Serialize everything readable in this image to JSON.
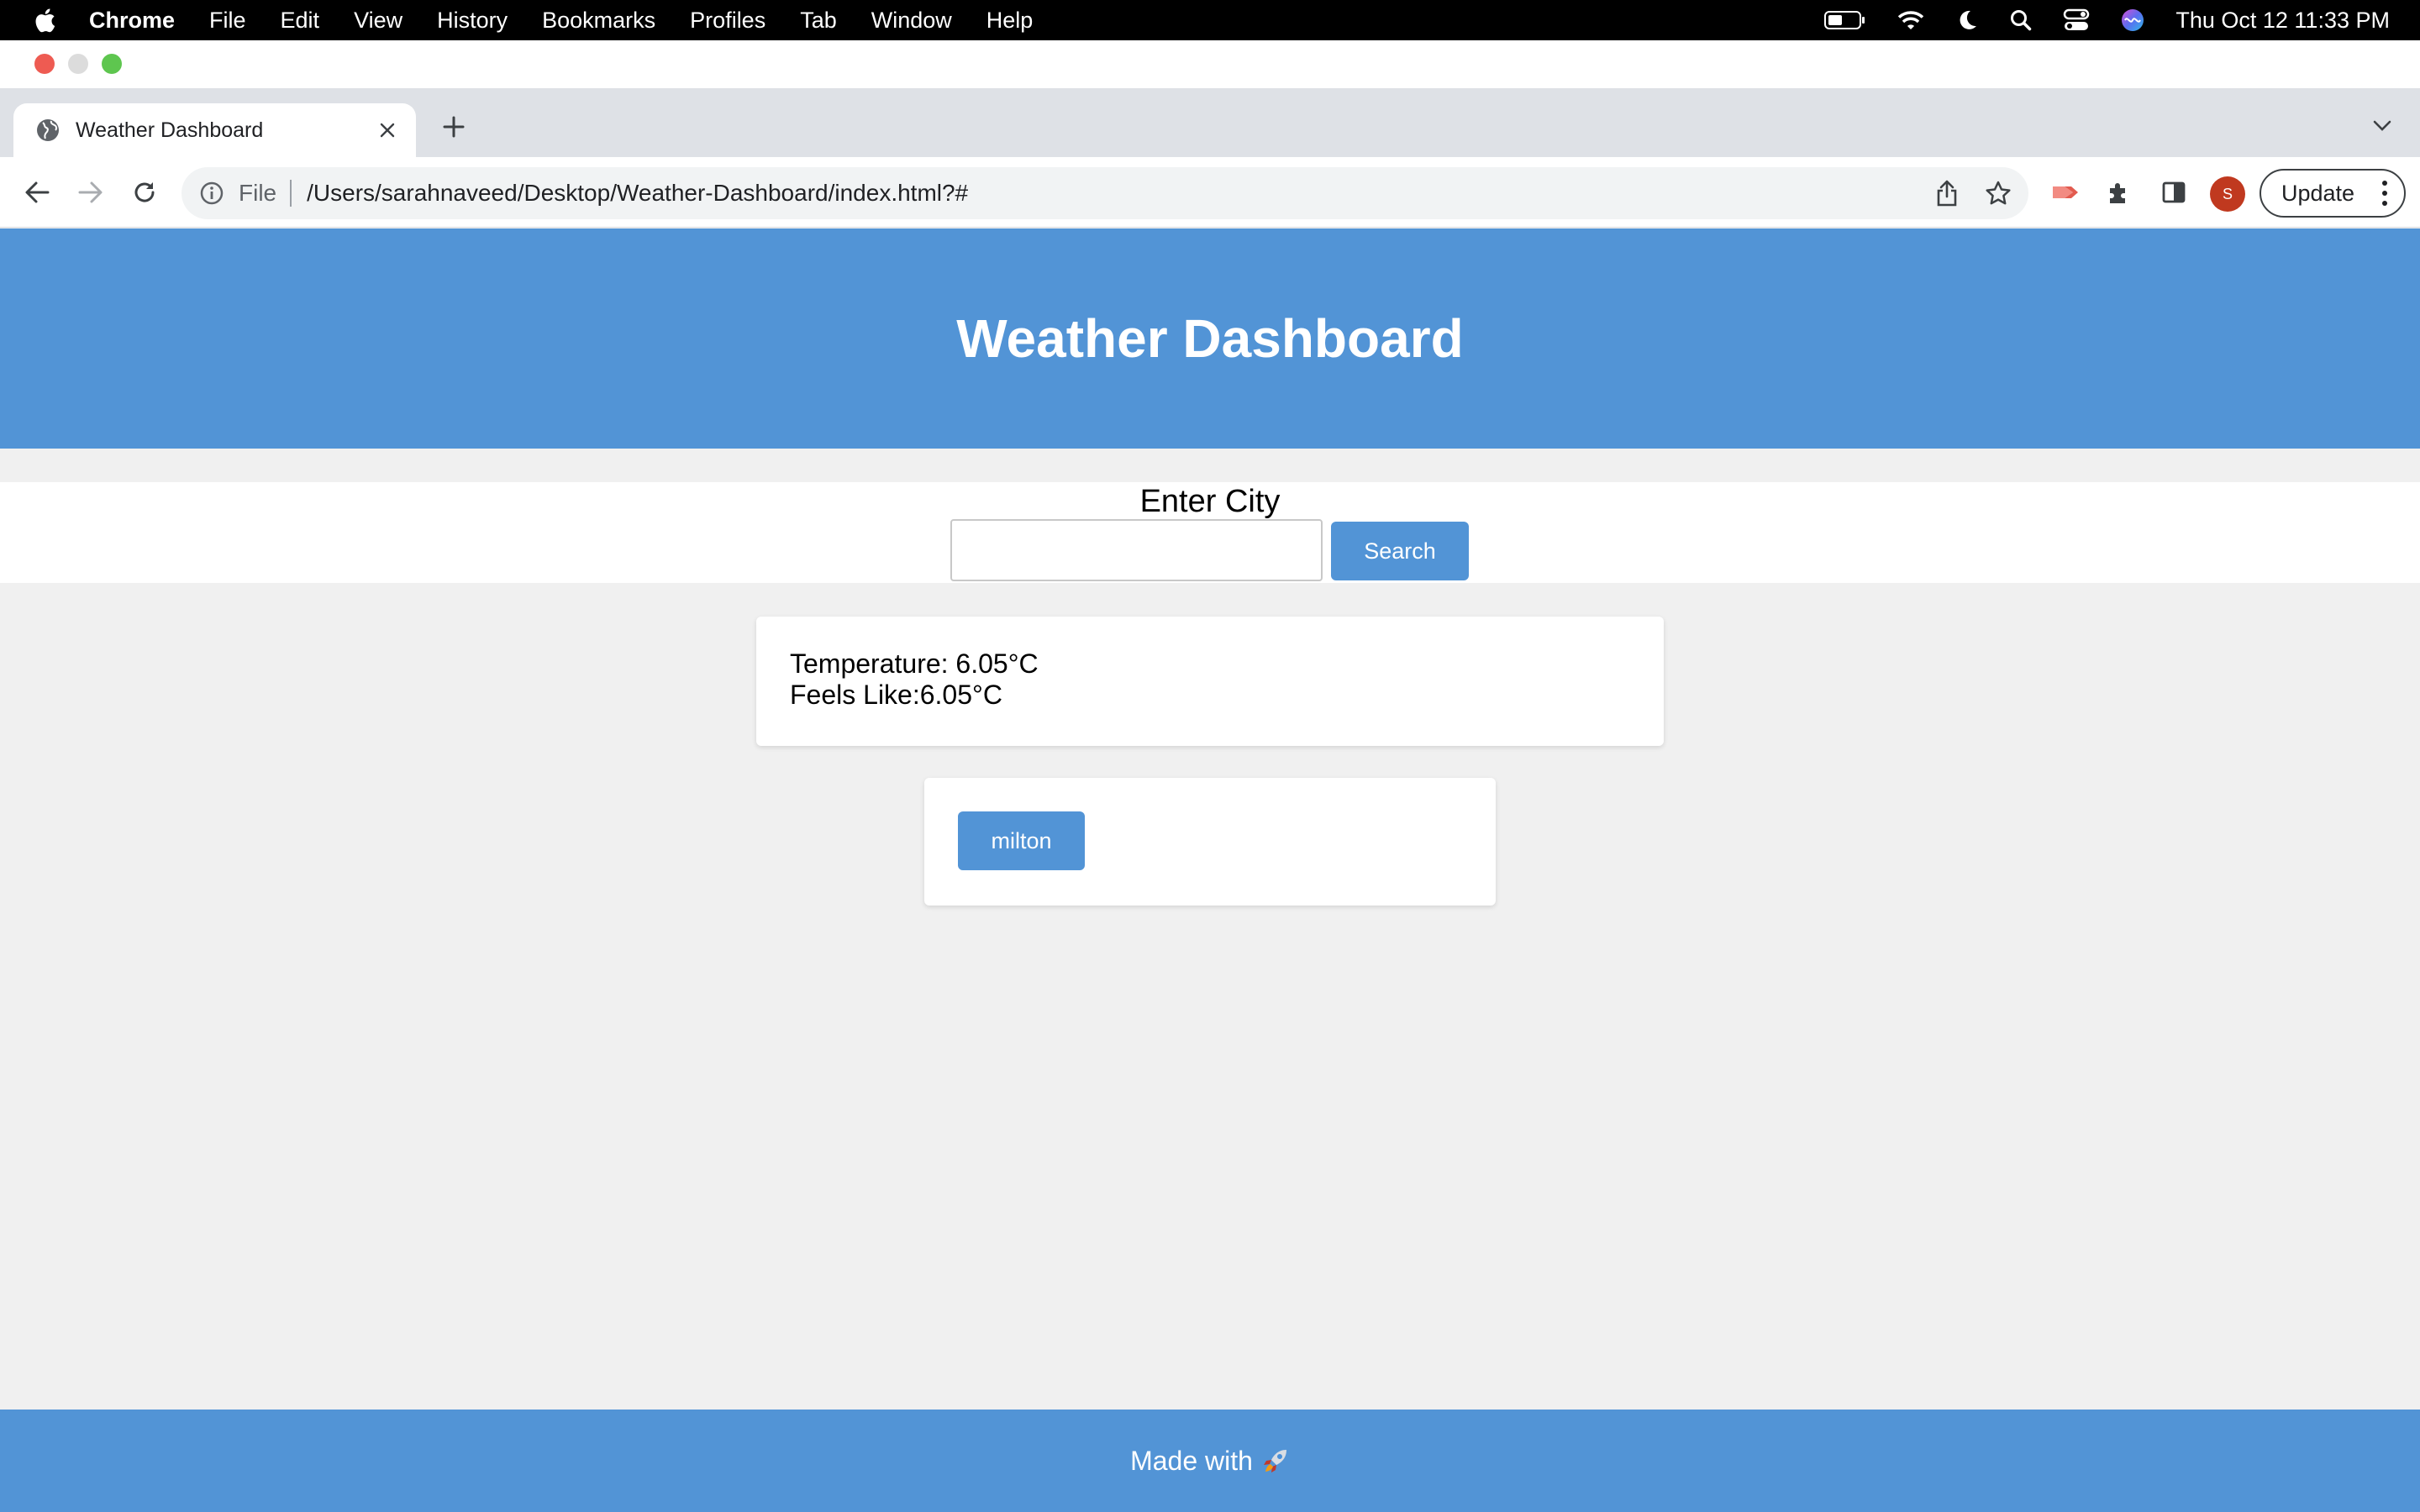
{
  "menubar": {
    "app_name": "Chrome",
    "items": [
      "File",
      "Edit",
      "View",
      "History",
      "Bookmarks",
      "Profiles",
      "Tab",
      "Window",
      "Help"
    ],
    "clock": "Thu Oct 12  11:33 PM"
  },
  "browser": {
    "tab": {
      "title": "Weather Dashboard"
    },
    "address": {
      "scheme": "File",
      "url": "/Users/sarahnaveed/Desktop/Weather-Dashboard/index.html?#"
    },
    "profile_initial": "S",
    "update_label": "Update"
  },
  "page": {
    "header": {
      "title": "Weather Dashboard"
    },
    "search": {
      "label": "Enter City",
      "input_value": "",
      "button_label": "Search"
    },
    "weather": {
      "temperature_text": "Temperature: 6.05°C",
      "feels_like_text": "Feels Like:6.05°C"
    },
    "history": {
      "items": [
        "milton"
      ]
    },
    "footer": {
      "text": "Made with"
    }
  },
  "colors": {
    "accent": "#5294d6",
    "page_background": "#f0f0f0"
  }
}
